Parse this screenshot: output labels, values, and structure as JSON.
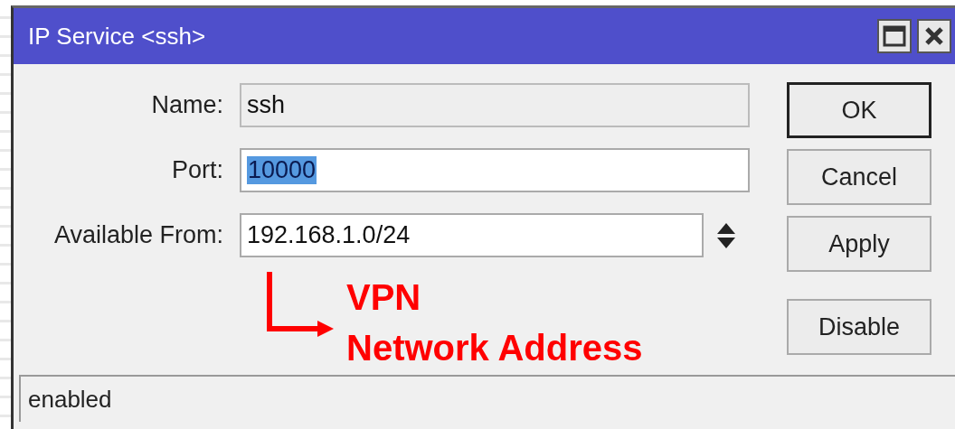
{
  "window": {
    "title": "IP Service <ssh>"
  },
  "title_buttons": [
    {
      "kind": "maximize"
    },
    {
      "kind": "close"
    }
  ],
  "fields": [
    {
      "kind": "text",
      "label": "Name:",
      "value": "ssh",
      "disabled": true,
      "text_selected": false
    },
    {
      "kind": "text",
      "label": "Port:",
      "value": "10000",
      "disabled": false,
      "text_selected": true
    },
    {
      "kind": "list",
      "label": "Available From:",
      "value": "192.168.1.0/24",
      "disabled": false,
      "text_selected": false
    }
  ],
  "buttons": [
    {
      "label": "OK",
      "default": true
    },
    {
      "label": "Cancel",
      "default": false
    },
    {
      "label": "Apply",
      "default": false
    },
    {
      "label": "Disable",
      "default": false,
      "separated": true
    }
  ],
  "annotation": {
    "lines": [
      "VPN",
      "Network Address"
    ]
  },
  "status_bar": "enabled"
}
